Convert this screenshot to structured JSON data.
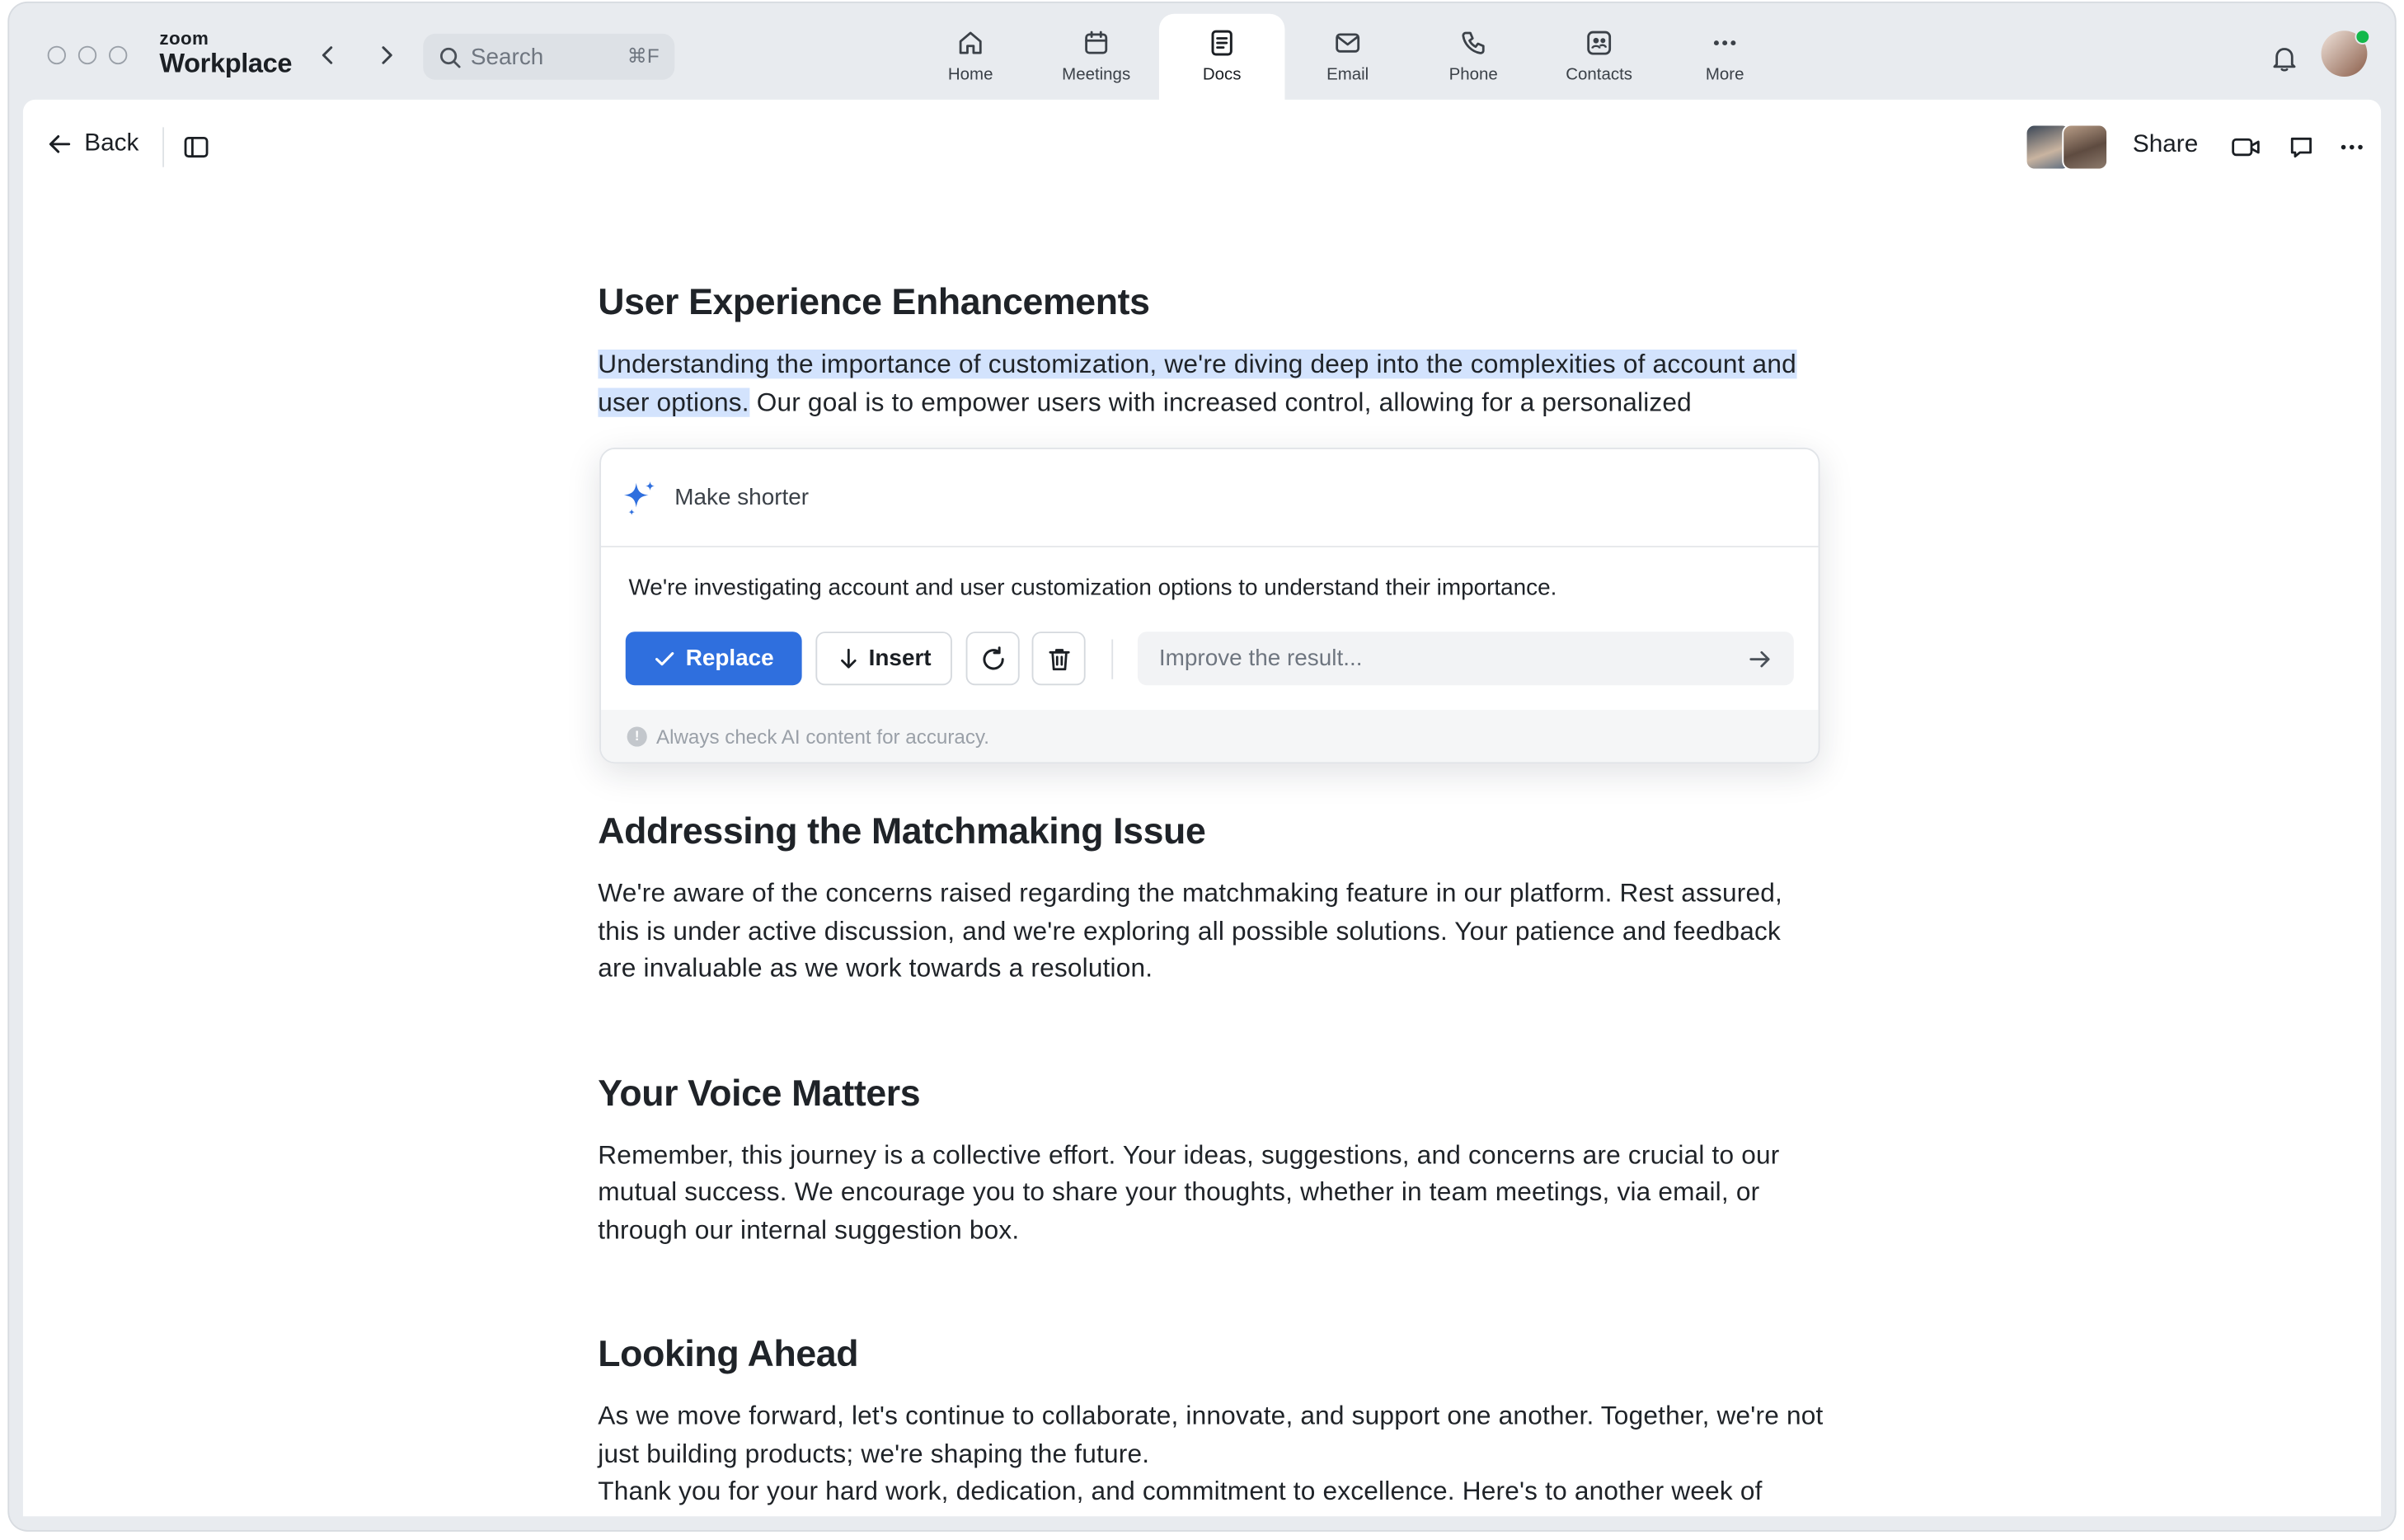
{
  "app": {
    "brand_small": "zoom",
    "brand_big": "Workplace"
  },
  "search": {
    "placeholder": "Search",
    "shortcut": "⌘F"
  },
  "tabs": [
    {
      "label": "Home",
      "icon": "home-icon"
    },
    {
      "label": "Meetings",
      "icon": "calendar-icon"
    },
    {
      "label": "Docs",
      "icon": "document-icon",
      "active": true
    },
    {
      "label": "Email",
      "icon": "email-icon"
    },
    {
      "label": "Phone",
      "icon": "phone-icon"
    },
    {
      "label": "Contacts",
      "icon": "contacts-icon"
    },
    {
      "label": "More",
      "icon": "more-icon"
    }
  ],
  "toolbar": {
    "back_label": "Back",
    "share_label": "Share"
  },
  "colors": {
    "accent": "#2f6fde",
    "selection": "#d3e3fd",
    "online": "#12b84a"
  },
  "doc": {
    "s1_title": "User Experience Enhancements",
    "s1_selected": "Understanding the importance of customization, we're diving deep into the complexities of account and user options.",
    "s1_rest": " Our goal is to empower users with increased control, allowing for a personalized experience that meets their unique needs. We're exploring various configurations",
    "s2_title": "Addressing the Matchmaking Issue",
    "s2_body": "We're aware of the concerns raised regarding the matchmaking feature in our platform. Rest assured, this is under active discussion, and we're exploring all possible solutions. Your patience and feedback are invaluable as we work towards a resolution.",
    "s3_title": "Your Voice Matters",
    "s3_body": "Remember, this journey is a collective effort. Your ideas, suggestions, and concerns are crucial to our mutual success. We encourage you to share your thoughts, whether in team meetings, via email, or through our internal suggestion box.",
    "s4_title": "Looking Ahead",
    "s4_body1": "As we move forward, let's continue to collaborate, innovate, and support one another. Together, we're not just building products; we're shaping the future.",
    "s4_body2": "Thank you for your hard work, dedication, and commitment to excellence. Here's to another week of achievements and beyond!"
  },
  "ai": {
    "action_label": "Make shorter",
    "result": "We're investigating account and user customization options to understand their importance.",
    "replace_label": "Replace",
    "insert_label": "Insert",
    "improve_placeholder": "Improve the result...",
    "disclaimer": "Always check AI content for accuracy."
  }
}
